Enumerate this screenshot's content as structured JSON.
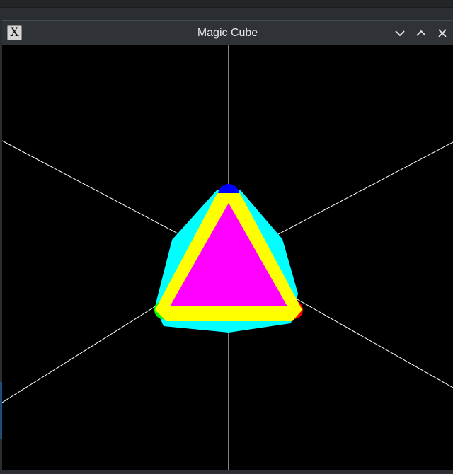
{
  "window": {
    "title": "Magic Cube",
    "app_icon_glyph": "X",
    "buttons": {
      "minimize_icon": "chevron-down-icon",
      "maximize_icon": "chevron-up-icon",
      "close_icon": "close-icon"
    }
  },
  "scene": {
    "background": "#000000",
    "axis_color": "#ffffff",
    "face_colors": {
      "front": "#ff00ff",
      "edge_band": "#ffff00",
      "side": "#00ffff",
      "corner_top": "#0000ff",
      "corner_left": "#00ff00",
      "corner_right": "#ff0000"
    }
  }
}
